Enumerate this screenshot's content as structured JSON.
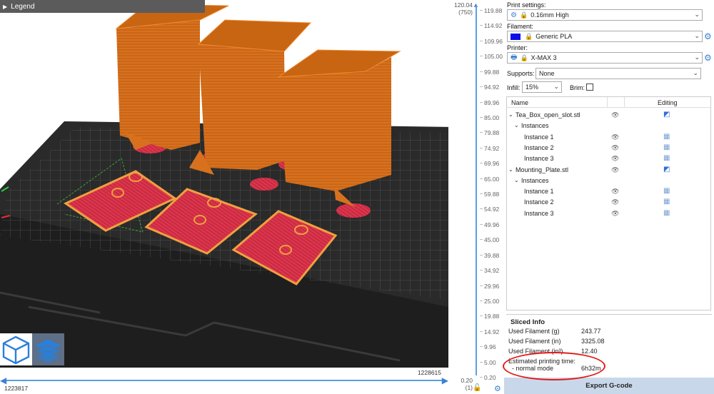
{
  "viewport": {
    "legend_label": "Legend",
    "h_slider": {
      "right_value": "1228615",
      "left_value": "1223817"
    },
    "v_slider": {
      "top_value": "120.04",
      "top_layer": "(750)",
      "bottom_value": "0.20",
      "bottom_layer": "(1)",
      "ticks": [
        "119.88",
        "114.92",
        "109.96",
        "105.00",
        "99.88",
        "94.92",
        "89.96",
        "85.00",
        "79.88",
        "74.92",
        "69.96",
        "65.00",
        "59.88",
        "54.92",
        "49.96",
        "45.00",
        "39.88",
        "34.92",
        "29.96",
        "25.00",
        "19.88",
        "14.92",
        "9.96",
        "5.00",
        "0.20"
      ]
    },
    "colors": {
      "model": "#d8711e",
      "infill": "#cf2a42",
      "bed": "#2e2e2e",
      "accent": "#3b82d6"
    },
    "icons": {
      "view_3d": "cube-icon",
      "view_layers": "layers-icon"
    }
  },
  "panel": {
    "print_settings_label": "Print settings:",
    "print_settings_value": "0.16mm High",
    "filament_label": "Filament:",
    "filament_value": "Generic PLA",
    "filament_color": "#0b10e8",
    "printer_label": "Printer:",
    "printer_value": "X-MAX 3",
    "supports_label": "Supports:",
    "supports_value": "None",
    "infill_label": "Infill:",
    "infill_value": "15%",
    "brim_label": "Brim:",
    "brim_checked": false,
    "list": {
      "col_name": "Name",
      "col_editing": "Editing",
      "rows": [
        {
          "label": "Tea_Box_open_slot.stl",
          "level": 0,
          "caret": "⌄",
          "edit": "obj"
        },
        {
          "label": "Instances",
          "level": 1,
          "caret": "⌄",
          "edit": ""
        },
        {
          "label": "Instance 1",
          "level": 2,
          "caret": "",
          "edit": "grid"
        },
        {
          "label": "Instance 2",
          "level": 2,
          "caret": "",
          "edit": "grid"
        },
        {
          "label": "Instance 3",
          "level": 2,
          "caret": "",
          "edit": "grid"
        },
        {
          "label": "Mounting_Plate.stl",
          "level": 0,
          "caret": "⌄",
          "edit": "obj"
        },
        {
          "label": "Instances",
          "level": 1,
          "caret": "⌄",
          "edit": ""
        },
        {
          "label": "Instance 1",
          "level": 2,
          "caret": "",
          "edit": "grid"
        },
        {
          "label": "Instance 2",
          "level": 2,
          "caret": "",
          "edit": "grid"
        },
        {
          "label": "Instance 3",
          "level": 2,
          "caret": "",
          "edit": "grid"
        }
      ]
    },
    "sliced": {
      "title": "Sliced Info",
      "used_g_label": "Used Filament (g)",
      "used_g_value": "243.77",
      "used_in_label": "Used Filament (in)",
      "used_in_value": "3325.08",
      "used_in2_label": "Used Filament (in³)",
      "used_in2_value": "12.40",
      "est_label": "Estimated printing time:",
      "mode_label": "- normal mode",
      "mode_value": "6h32m"
    },
    "export_label": "Export G-code"
  }
}
